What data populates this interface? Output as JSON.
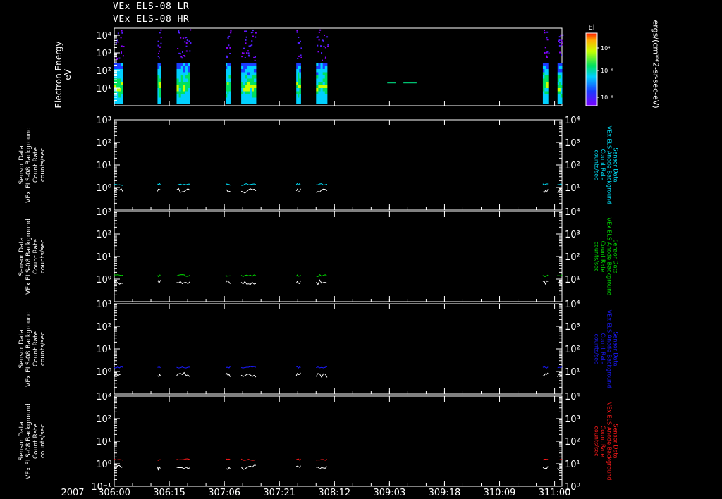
{
  "titles": [
    "VEx ELS-08 LR",
    "VEx ELS-08 HR"
  ],
  "year_label": "2007",
  "x_ticks": [
    "306:00",
    "306:15",
    "307:06",
    "307:21",
    "308:12",
    "309:03",
    "309:18",
    "310:09",
    "311:00"
  ],
  "colorbar": {
    "label": "El",
    "ticks": [
      "10⁴",
      "10⁻⁶",
      "10⁻⁸"
    ],
    "unit_label": "ergs/(cm**2-sr-sec-eV)",
    "log_range": [
      -9,
      -3
    ]
  },
  "spectrogram": {
    "ylabel_lines": [
      "Electron Energy",
      "eV"
    ],
    "ytick_labels": [
      "10⁴",
      "10³",
      "10²",
      "10¹"
    ],
    "log_ylim": [
      0,
      4.4
    ],
    "active_intervals": [
      [
        0.0,
        0.06
      ],
      [
        0.295,
        0.315
      ],
      [
        0.425,
        0.515
      ],
      [
        0.76,
        0.79
      ],
      [
        0.865,
        0.965
      ],
      [
        1.24,
        1.27
      ],
      [
        1.375,
        1.45
      ],
      [
        2.92,
        2.955
      ],
      [
        3.02,
        3.05
      ]
    ],
    "faint_segments": [
      [
        1.86,
        1.92
      ],
      [
        1.97,
        2.06
      ]
    ]
  },
  "chart_data": [
    {
      "type": "line",
      "title": "",
      "ylabel": "Sensor Data\nVEx ELS-08 Background\nCount Rate\ncounts/sec",
      "right_ylabel": "Sensor Data\nVEx ELS Anode Background\nCount Rate\ncounts/sec",
      "xlim": [
        0,
        3.05
      ],
      "xlabel_ticks": [
        "306:00",
        "306:15",
        "307:06",
        "307:21",
        "308:12",
        "309:03",
        "309:18",
        "310:09",
        "311:00"
      ],
      "log_ylim": [
        -1,
        3
      ],
      "right_log_ylim": [
        0,
        4
      ],
      "left_ticks": [
        "10³",
        "10²",
        "10¹",
        "10⁰"
      ],
      "right_ticks": [
        "10⁴",
        "10³",
        "10²",
        "10¹"
      ],
      "series": [
        {
          "color": "#00e5ff",
          "values": [
            0.09,
            0.17
          ]
        },
        {
          "color": "#ffffff",
          "values": [
            -0.08,
            -0.03
          ]
        }
      ],
      "segments": [
        [
          0.0,
          0.06
        ],
        [
          0.295,
          0.315
        ],
        [
          0.425,
          0.515
        ],
        [
          0.76,
          0.79
        ],
        [
          0.865,
          0.965
        ],
        [
          1.24,
          1.27
        ],
        [
          1.375,
          1.45
        ],
        [
          2.92,
          2.955
        ],
        [
          3.02,
          3.05
        ]
      ]
    },
    {
      "type": "line",
      "title": "",
      "ylabel": "Sensor Data\nVEx ELS-08 Background\nCount Rate\ncounts/sec",
      "right_ylabel": "Sensor Data\nVEx ELS Anode Background\nCount Rate\ncounts/sec",
      "xlim": [
        0,
        3.05
      ],
      "log_ylim": [
        -1,
        3
      ],
      "right_log_ylim": [
        0,
        4
      ],
      "left_ticks": [
        "10³",
        "10²",
        "10¹",
        "10⁰"
      ],
      "right_ticks": [
        "10⁴",
        "10³",
        "10²",
        "10¹"
      ],
      "series": [
        {
          "color": "#00e000",
          "values": [
            0.11,
            0.2
          ]
        },
        {
          "color": "#ffffff",
          "values": [
            -0.1,
            -0.03
          ]
        }
      ],
      "segments": [
        [
          0.0,
          0.06
        ],
        [
          0.295,
          0.315
        ],
        [
          0.425,
          0.515
        ],
        [
          0.76,
          0.79
        ],
        [
          0.865,
          0.965
        ],
        [
          1.24,
          1.27
        ],
        [
          1.375,
          1.45
        ],
        [
          2.92,
          2.955
        ],
        [
          3.02,
          3.05
        ]
      ]
    },
    {
      "type": "line",
      "title": "",
      "ylabel": "Sensor Data\nVEx ELS-08 Background\nCount Rate\ncounts/sec",
      "right_ylabel": "Sensor Data\nVEx ELS Anode Background\nCount Rate\ncounts/sec",
      "xlim": [
        0,
        3.05
      ],
      "log_ylim": [
        -1,
        3
      ],
      "right_log_ylim": [
        0,
        4
      ],
      "left_ticks": [
        "10³",
        "10²",
        "10¹",
        "10⁰"
      ],
      "right_ticks": [
        "10⁴",
        "10³",
        "10²",
        "10¹"
      ],
      "series": [
        {
          "color": "#1a1aff",
          "values": [
            0.15,
            0.22
          ]
        },
        {
          "color": "#ffffff",
          "values": [
            -0.1,
            -0.02
          ]
        }
      ],
      "segments": [
        [
          0.0,
          0.06
        ],
        [
          0.295,
          0.315
        ],
        [
          0.425,
          0.515
        ],
        [
          0.76,
          0.79
        ],
        [
          0.865,
          0.965
        ],
        [
          1.24,
          1.27
        ],
        [
          1.375,
          1.45
        ],
        [
          2.92,
          2.955
        ],
        [
          3.02,
          3.05
        ]
      ]
    },
    {
      "type": "line",
      "title": "",
      "ylabel": "Sensor Data\nVEx ELS-08 Background\nCount Rate\ncounts/sec",
      "right_ylabel": "Sensor Data\nVEx ELS Anode Background\nCount Rate\ncounts/sec",
      "xlim": [
        0,
        3.05
      ],
      "log_ylim": [
        -1,
        3
      ],
      "right_log_ylim": [
        0,
        4
      ],
      "left_ticks": [
        "10³",
        "10²",
        "10¹",
        "10⁰",
        "10⁻¹"
      ],
      "right_ticks": [
        "10⁴",
        "10³",
        "10²",
        "10¹",
        "10⁰"
      ],
      "series": [
        {
          "color": "#ff1a1a",
          "values": [
            0.15,
            0.22
          ]
        },
        {
          "color": "#ffffff",
          "values": [
            -0.12,
            -0.04
          ]
        }
      ],
      "segments": [
        [
          0.0,
          0.06
        ],
        [
          0.295,
          0.315
        ],
        [
          0.425,
          0.515
        ],
        [
          0.76,
          0.79
        ],
        [
          0.865,
          0.965
        ],
        [
          1.24,
          1.27
        ],
        [
          1.375,
          1.45
        ],
        [
          2.92,
          2.955
        ],
        [
          3.02,
          3.05
        ]
      ]
    }
  ]
}
